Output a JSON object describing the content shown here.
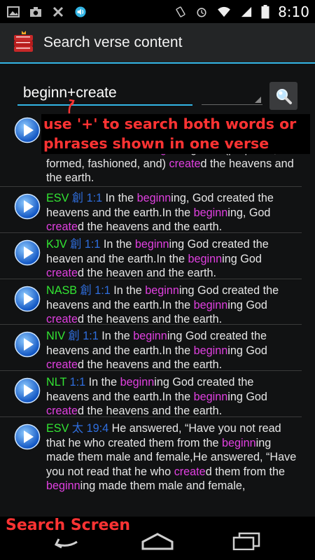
{
  "status_bar": {
    "time": "8:10",
    "left_icons": [
      "gallery-icon",
      "camera-icon",
      "usb-icon",
      "sound-icon"
    ],
    "right_icons": [
      "rotate-icon",
      "alarm-icon",
      "wifi-icon",
      "signal-icon",
      "battery-icon"
    ]
  },
  "action_bar": {
    "title": "Search verse content",
    "icon": "bible-book-icon"
  },
  "search": {
    "value": "beginn+create",
    "button_icon": "search-icon"
  },
  "annotation": {
    "text": "use '+' to search both words or phrases shown in one verse",
    "label": "Search Screen",
    "color": "#ff3333"
  },
  "results": [
    {
      "text_parts": [
        {
          "t": "and the earth.In the ",
          "c": "n"
        },
        {
          "t": "beginn",
          "c": "h"
        },
        {
          "t": "ing God (prepared, formed, fashioned, and) ",
          "c": "n"
        },
        {
          "t": "create",
          "c": "h"
        },
        {
          "t": "d the heavens and the earth.",
          "c": "n"
        }
      ]
    },
    {
      "version": "ESV",
      "book": "創",
      "ref": "1:1",
      "text_parts": [
        {
          "t": " In the ",
          "c": "n"
        },
        {
          "t": "beginn",
          "c": "h"
        },
        {
          "t": "ing, God created the heavens and the earth.In the ",
          "c": "n"
        },
        {
          "t": "beginn",
          "c": "h"
        },
        {
          "t": "ing, God ",
          "c": "n"
        },
        {
          "t": "create",
          "c": "h"
        },
        {
          "t": "d the heavens and the earth.",
          "c": "n"
        }
      ]
    },
    {
      "version": "KJV",
      "book": "創",
      "ref": "1:1",
      "text_parts": [
        {
          "t": " In the ",
          "c": "n"
        },
        {
          "t": "beginn",
          "c": "h"
        },
        {
          "t": "ing God created the heaven and the earth.In the ",
          "c": "n"
        },
        {
          "t": "beginn",
          "c": "h"
        },
        {
          "t": "ing God ",
          "c": "n"
        },
        {
          "t": "create",
          "c": "h"
        },
        {
          "t": "d the heaven and the earth.",
          "c": "n"
        }
      ]
    },
    {
      "version": "NASB",
      "book": "創",
      "ref": "1:1",
      "text_parts": [
        {
          "t": " In the ",
          "c": "n"
        },
        {
          "t": "beginn",
          "c": "h"
        },
        {
          "t": "ing God created the heavens and the earth.In the ",
          "c": "n"
        },
        {
          "t": "beginn",
          "c": "h"
        },
        {
          "t": "ing God ",
          "c": "n"
        },
        {
          "t": "create",
          "c": "h"
        },
        {
          "t": "d the heavens and the earth.",
          "c": "n"
        }
      ]
    },
    {
      "version": "NIV",
      "book": "創",
      "ref": "1:1",
      "text_parts": [
        {
          "t": " In the ",
          "c": "n"
        },
        {
          "t": "beginn",
          "c": "h"
        },
        {
          "t": "ing God created the heavens and the earth.In the ",
          "c": "n"
        },
        {
          "t": "beginn",
          "c": "h"
        },
        {
          "t": "ing God ",
          "c": "n"
        },
        {
          "t": "create",
          "c": "h"
        },
        {
          "t": "d the heavens and the earth.",
          "c": "n"
        }
      ]
    },
    {
      "version": "NLT",
      "book": "",
      "ref": "1:1",
      "text_parts": [
        {
          "t": " In the ",
          "c": "n"
        },
        {
          "t": "beginn",
          "c": "h"
        },
        {
          "t": "ing God created the heavens and the earth.In the ",
          "c": "n"
        },
        {
          "t": "beginn",
          "c": "h"
        },
        {
          "t": "ing God ",
          "c": "n"
        },
        {
          "t": "create",
          "c": "h"
        },
        {
          "t": "d the heavens and the earth.",
          "c": "n"
        }
      ]
    },
    {
      "version": "ESV",
      "book": "太",
      "ref": "19:4",
      "text_parts": [
        {
          "t": " He answered, “Have you not read that he who created them from the ",
          "c": "n"
        },
        {
          "t": "beginn",
          "c": "h"
        },
        {
          "t": "ing made them male and female,He answered, “Have you not read that he who ",
          "c": "n"
        },
        {
          "t": "create",
          "c": "h"
        },
        {
          "t": "d them from the ",
          "c": "n"
        },
        {
          "t": "beginn",
          "c": "h"
        },
        {
          "t": "ing made them male and female,",
          "c": "n"
        }
      ]
    }
  ],
  "nav": {
    "back": "back-icon",
    "home": "home-icon",
    "recents": "recents-icon"
  },
  "colors": {
    "accent": "#33b5e5",
    "highlight": "#e040e0",
    "version": "#33e633",
    "reference": "#2f6fe0"
  }
}
